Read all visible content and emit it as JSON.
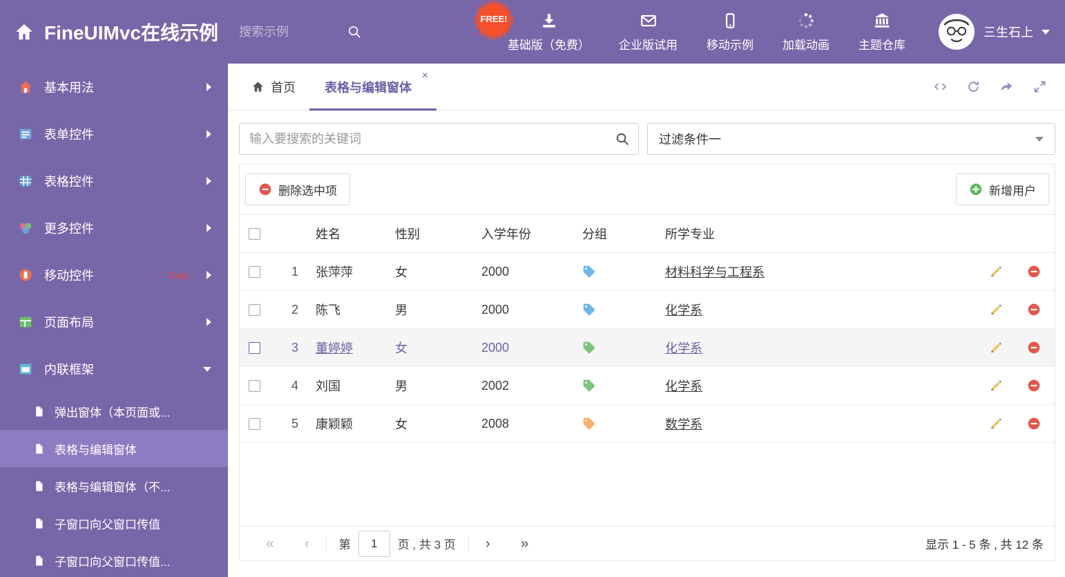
{
  "colors": {
    "theme_purple": "#7767a8",
    "active_purple": "#8d7cc2",
    "accent": "#6e5fa5",
    "corp_red": "#ff4438",
    "free_red": "#f4502c",
    "red": "#e2574c",
    "green": "#61b861",
    "tag_blue": "#72b8e8",
    "tag_green": "#7fc47f",
    "tag_orange": "#f5b26b"
  },
  "header": {
    "title": "FineUIMvc在线示例",
    "search_placeholder": "搜索示例",
    "free": "FREE!",
    "nav": [
      {
        "id": "basic-free",
        "icon": "download-icon",
        "label": "基础版（免费）"
      },
      {
        "id": "enterprise-trial",
        "icon": "envelope-icon",
        "label": "企业版试用"
      },
      {
        "id": "mobile-demo",
        "icon": "mobile-icon",
        "label": "移动示例"
      },
      {
        "id": "loading-anim",
        "icon": "spinner-icon",
        "label": "加载动画"
      },
      {
        "id": "theme-store",
        "icon": "bank-icon",
        "label": "主题仓库"
      }
    ],
    "user": "三生石上"
  },
  "sidebar": {
    "items": [
      {
        "id": "basic",
        "icon": "home-colored-icon",
        "label": "基本用法"
      },
      {
        "id": "form",
        "icon": "form-icon",
        "label": "表单控件"
      },
      {
        "id": "grid",
        "icon": "grid-icon",
        "label": "表格控件"
      },
      {
        "id": "more",
        "icon": "widgets-icon",
        "label": "更多控件"
      },
      {
        "id": "mobile",
        "icon": "mobile-colored-icon",
        "label": "移动控件",
        "badge": "Corp."
      },
      {
        "id": "layout",
        "icon": "layout-icon",
        "label": "页面布局"
      },
      {
        "id": "iframe",
        "icon": "frame-icon",
        "label": "内联框架",
        "expanded": true,
        "children": [
          {
            "id": "popup-window",
            "label": "弹出窗体（本页面或..."
          },
          {
            "id": "grid-edit-window",
            "label": "表格与编辑窗体",
            "active": true
          },
          {
            "id": "grid-edit-window-2",
            "label": "表格与编辑窗体（不..."
          },
          {
            "id": "child-to-parent",
            "label": "子窗口向父窗口传值"
          },
          {
            "id": "child-to-parent-2",
            "label": "子窗口向父窗口传值..."
          }
        ]
      }
    ]
  },
  "tabs": {
    "home": "首页",
    "active": "表格与编辑窗体",
    "tools": [
      {
        "id": "source-code",
        "icon": "code-icon"
      },
      {
        "id": "refresh",
        "icon": "refresh-icon"
      },
      {
        "id": "share",
        "icon": "share-icon"
      },
      {
        "id": "fullscreen",
        "icon": "expand-icon"
      }
    ]
  },
  "filters": {
    "search_placeholder": "输入要搜索的关键词",
    "filter_value": "过滤条件一"
  },
  "toolbar": {
    "delete": "删除选中项",
    "add": "新增用户"
  },
  "table": {
    "columns": [
      "姓名",
      "性别",
      "入学年份",
      "分组",
      "所学专业"
    ],
    "rows": [
      {
        "num": "1",
        "name": "张萍萍",
        "gender": "女",
        "year": "2000",
        "tag": "blue",
        "major": "材料科学与工程系",
        "selected": false
      },
      {
        "num": "2",
        "name": "陈飞",
        "gender": "男",
        "year": "2000",
        "tag": "blue",
        "major": "化学系",
        "selected": false
      },
      {
        "num": "3",
        "name": "董婷婷",
        "gender": "女",
        "year": "2000",
        "tag": "green",
        "major": "化学系",
        "selected": true
      },
      {
        "num": "4",
        "name": "刘国",
        "gender": "男",
        "year": "2002",
        "tag": "green",
        "major": "化学系",
        "selected": false
      },
      {
        "num": "5",
        "name": "康颖颖",
        "gender": "女",
        "year": "2008",
        "tag": "orange",
        "major": "数学系",
        "selected": false
      }
    ]
  },
  "pagination": {
    "first": "«",
    "prev": "‹",
    "page_prefix": "第",
    "page": "1",
    "page_suffix": "页 , 共 3 页",
    "next": "›",
    "last": "»",
    "info": "显示 1 - 5 条 , 共 12 条"
  }
}
